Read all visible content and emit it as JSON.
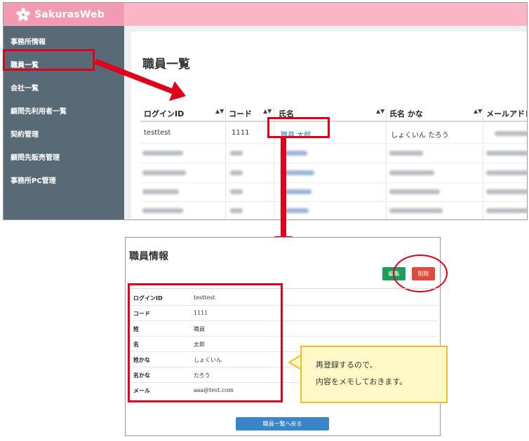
{
  "brand": {
    "name": "SakurasWeb"
  },
  "sidebar": {
    "items": [
      {
        "label": "事務所情報"
      },
      {
        "label": "職員一覧"
      },
      {
        "label": "会社一覧"
      },
      {
        "label": "顧問先利用者一覧"
      },
      {
        "label": "契約管理"
      },
      {
        "label": "顧問先販売管理"
      },
      {
        "label": "事務所PC管理"
      }
    ]
  },
  "list": {
    "title": "職員一覧",
    "columns": [
      "ログインID",
      "コード",
      "氏名",
      "氏名 かな",
      "メールアドレ"
    ],
    "first_row": {
      "login_id": "testtest",
      "code": "1111",
      "name": "職員 太郎",
      "name_kana": "しょくいん たろう"
    },
    "sort_icon": "sort-both-icon"
  },
  "detail": {
    "title": "職員情報",
    "edit_label": "編集",
    "delete_label": "削除",
    "back_label": "職員一覧へ戻る",
    "fields": [
      {
        "label": "ログインID",
        "value": "testtest"
      },
      {
        "label": "コード",
        "value": "1111"
      },
      {
        "label": "姓",
        "value": "職員"
      },
      {
        "label": "名",
        "value": "太郎"
      },
      {
        "label": "姓かな",
        "value": "しょくいん"
      },
      {
        "label": "名かな",
        "value": "たろう"
      },
      {
        "label": "メール",
        "value": "aaa@test.com"
      }
    ]
  },
  "callout": {
    "lines": [
      "再登録するので、",
      "内容をメモしておきます。"
    ]
  },
  "colors": {
    "header_pink": "#fbb6c8",
    "sidebar": "#586a76",
    "annotation_red": "#e0001b",
    "link_blue": "#2a6fb0",
    "edit_green": "#1e9e5a",
    "delete_red": "#e04a3d",
    "back_blue": "#3a86c8",
    "callout_fill": "#fff9c7",
    "callout_border": "#f2bb2b"
  }
}
